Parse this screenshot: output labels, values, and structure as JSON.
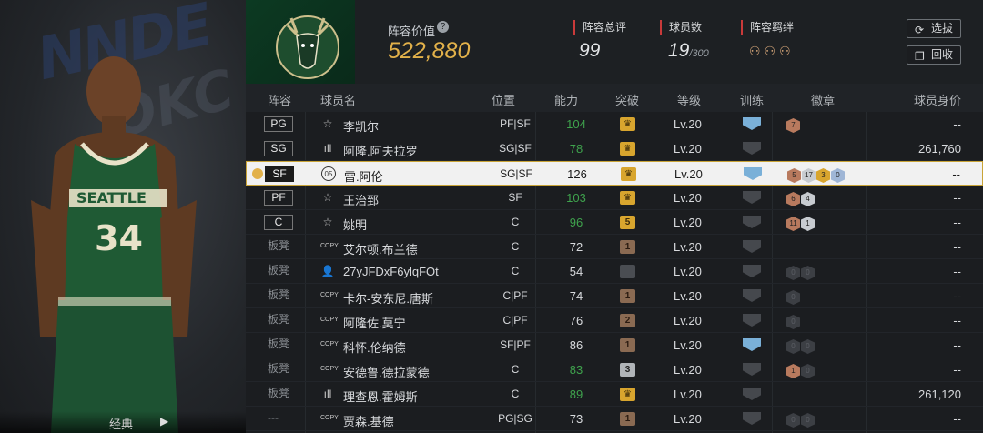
{
  "player_panel": {
    "series_label": "经典",
    "next_arrow": "▶"
  },
  "header": {
    "value_label": "阵容价值",
    "value": "522,880",
    "rating_label": "阵容总评",
    "rating": "99",
    "count_label": "球员数",
    "count": "19",
    "count_max": "/300",
    "bond_label": "阵容羁绊",
    "btn_select": "选拔",
    "btn_recycle": "回收"
  },
  "columns": {
    "lineup": "阵容",
    "name": "球员名",
    "position": "位置",
    "ability": "能力",
    "breakthrough": "突破",
    "level": "等级",
    "training": "训练",
    "badges": "徽章",
    "value": "球员身价"
  },
  "colors": {
    "accent": "#e2b14a",
    "green": "#3fa34d",
    "selected_row": "#f1f1f1"
  },
  "rows": [
    {
      "slot": "PG",
      "type": "star",
      "name": "李凯尔",
      "pos": "PF|SF",
      "ability": "104",
      "green": true,
      "brk": "gold",
      "brk_text": "♛",
      "level": "Lv.20",
      "train": true,
      "badges": [
        [
          "bronze",
          "7"
        ]
      ],
      "price": "--"
    },
    {
      "slot": "SG",
      "type": "bars",
      "name": "阿隆.阿夫拉罗",
      "pos": "SG|SF",
      "ability": "78",
      "green": true,
      "brk": "gold",
      "brk_text": "♛",
      "level": "Lv.20",
      "train": false,
      "badges": [],
      "price": "261,760"
    },
    {
      "slot": "SF",
      "type": "05",
      "name": "雷.阿伦",
      "pos": "SG|SF",
      "ability": "126",
      "green": false,
      "brk": "gold",
      "brk_text": "♛",
      "level": "Lv.20",
      "train": true,
      "badges": [
        [
          "bronze",
          "5"
        ],
        [
          "silver",
          "17"
        ],
        [
          "gold",
          "3"
        ],
        [
          "blue",
          "0"
        ]
      ],
      "price": "--",
      "selected": true
    },
    {
      "slot": "PF",
      "type": "star",
      "name": "王治郅",
      "pos": "SF",
      "ability": "103",
      "green": true,
      "brk": "gold",
      "brk_text": "♛",
      "level": "Lv.20",
      "train": false,
      "badges": [
        [
          "bronze",
          "6"
        ],
        [
          "silver",
          "4"
        ]
      ],
      "price": "--"
    },
    {
      "slot": "C",
      "type": "star",
      "name": "姚明",
      "pos": "C",
      "ability": "96",
      "green": true,
      "brk": "gold",
      "brk_text": "5",
      "level": "Lv.20",
      "train": false,
      "badges": [
        [
          "bronze",
          "11"
        ],
        [
          "silver",
          "1"
        ]
      ],
      "price": "--"
    },
    {
      "slot": "板凳",
      "type": "copy",
      "name": "艾尔顿.布兰德",
      "pos": "C",
      "ability": "72",
      "green": false,
      "brk": "brown",
      "brk_text": "1",
      "level": "Lv.20",
      "train": false,
      "badges": [],
      "price": "--"
    },
    {
      "slot": "板凳",
      "type": "user",
      "name": "27yJFDxF6ylqFOt",
      "pos": "C",
      "ability": "54",
      "green": false,
      "brk": "gray",
      "brk_text": "",
      "level": "Lv.20",
      "train": false,
      "badges": [
        [
          "dim",
          "0"
        ],
        [
          "dim",
          "0"
        ]
      ],
      "price": "--"
    },
    {
      "slot": "板凳",
      "type": "copy",
      "name": "卡尔-安东尼.唐斯",
      "pos": "C|PF",
      "ability": "74",
      "green": false,
      "brk": "brown",
      "brk_text": "1",
      "level": "Lv.20",
      "train": false,
      "badges": [
        [
          "dim",
          "0"
        ]
      ],
      "price": "--"
    },
    {
      "slot": "板凳",
      "type": "copy",
      "name": "阿隆佐.莫宁",
      "pos": "C|PF",
      "ability": "76",
      "green": false,
      "brk": "brown",
      "brk_text": "2",
      "level": "Lv.20",
      "train": false,
      "badges": [
        [
          "dim",
          "0"
        ]
      ],
      "price": "--"
    },
    {
      "slot": "板凳",
      "type": "copy",
      "name": "科怀.伦纳德",
      "pos": "SF|PF",
      "ability": "86",
      "green": false,
      "brk": "brown",
      "brk_text": "1",
      "level": "Lv.20",
      "train": true,
      "badges": [
        [
          "dim",
          "0"
        ],
        [
          "dim",
          "0"
        ]
      ],
      "price": "--"
    },
    {
      "slot": "板凳",
      "type": "copy",
      "name": "安德鲁.德拉蒙德",
      "pos": "C",
      "ability": "83",
      "green": true,
      "brk": "silver",
      "brk_text": "3",
      "level": "Lv.20",
      "train": false,
      "badges": [
        [
          "bronze",
          "1"
        ],
        [
          "dim",
          "0"
        ]
      ],
      "price": "--"
    },
    {
      "slot": "板凳",
      "type": "bars",
      "name": "理查恩.霍姆斯",
      "pos": "C",
      "ability": "89",
      "green": true,
      "brk": "gold",
      "brk_text": "♛",
      "level": "Lv.20",
      "train": false,
      "badges": [],
      "price": "261,120"
    },
    {
      "slot": "---",
      "type": "copy",
      "name": "贾森.基德",
      "pos": "PG|SG",
      "ability": "73",
      "green": false,
      "brk": "brown",
      "brk_text": "1",
      "level": "Lv.20",
      "train": false,
      "badges": [
        [
          "dim",
          "0"
        ],
        [
          "dim",
          "0"
        ]
      ],
      "price": "--"
    }
  ]
}
